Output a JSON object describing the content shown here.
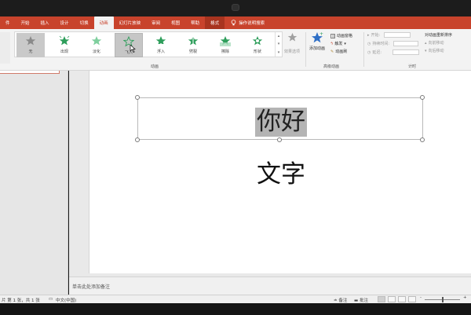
{
  "tabs": [
    {
      "label": "件",
      "active": false
    },
    {
      "label": "开始",
      "active": false
    },
    {
      "label": "插入",
      "active": false
    },
    {
      "label": "设计",
      "active": false
    },
    {
      "label": "切换",
      "active": false
    },
    {
      "label": "动画",
      "active": true
    },
    {
      "label": "幻灯片放映",
      "active": false
    },
    {
      "label": "审阅",
      "active": false
    },
    {
      "label": "视图",
      "active": false
    },
    {
      "label": "帮助",
      "active": false
    },
    {
      "label": "格式",
      "active": false
    }
  ],
  "tell_me": "操作说明搜索",
  "gallery": {
    "effects": [
      "无",
      "出现",
      "淡化",
      "飞入",
      "浮入",
      "劈裂",
      "擦除",
      "形状"
    ],
    "group_label": "动画"
  },
  "effect_options_label": "效果选项",
  "advanced": {
    "add_animation": "添加动画",
    "animation_pane": "动画窗格",
    "trigger": "触发",
    "painter": "动画刷",
    "group_label": "高级动画"
  },
  "timing": {
    "start": "开始:",
    "duration": "持续时间:",
    "delay": "延迟:",
    "reorder_title": "对动画重新排序",
    "move_earlier": "向前移动",
    "move_later": "向后移动",
    "group_label": "计时"
  },
  "slide": {
    "line1": "你好",
    "line2": "文字"
  },
  "notes_placeholder": "单击此处添加备注",
  "status": {
    "slide_info": "片 第 1 张，共 1 张",
    "language": "中文(中国)",
    "notes": "备注",
    "comments": "批注"
  },
  "colors": {
    "accent": "#c8432c",
    "star_green": "#2e9e5b"
  }
}
